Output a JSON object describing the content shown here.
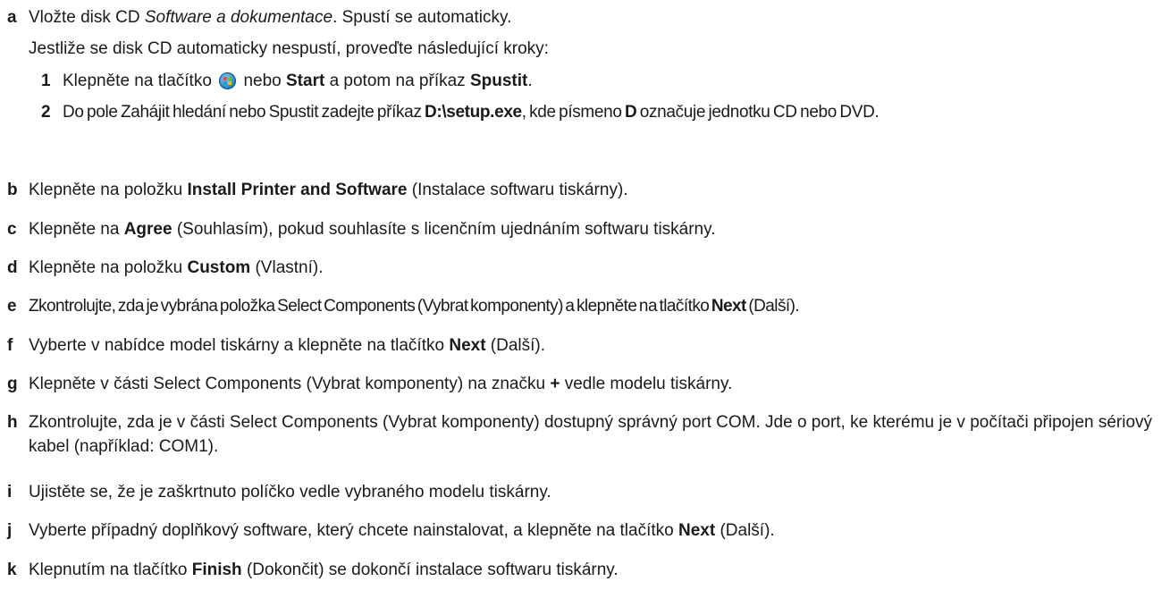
{
  "steps": [
    {
      "letter": "a",
      "parts": [
        "Vložte disk CD ",
        "Software a dokumentace",
        ". Spustí se automaticky."
      ],
      "line2": "Jestliže se disk CD automaticky nespustí, proveďte následující kroky:",
      "substeps": [
        {
          "num": "1",
          "parts": [
            "Klepněte na tlačítko ",
            " nebo ",
            "Start",
            " a potom na příkaz ",
            "Spustit",
            "."
          ]
        },
        {
          "num": "2",
          "parts": [
            "Do pole Zahájit hledání nebo Spustit zadejte příkaz ",
            "D:\\setup.exe",
            ", kde písmeno ",
            "D",
            " označuje jednotku CD nebo DVD."
          ]
        }
      ]
    },
    {
      "letter": "b",
      "parts": [
        "Klepněte na položku ",
        "Install Printer and Software",
        " (Instalace softwaru tiskárny)."
      ]
    },
    {
      "letter": "c",
      "parts": [
        "Klepněte na ",
        "Agree",
        " (Souhlasím), pokud souhlasíte s licenčním ujednáním softwaru tiskárny."
      ]
    },
    {
      "letter": "d",
      "parts": [
        "Klepněte na položku ",
        "Custom",
        " (Vlastní)."
      ]
    },
    {
      "letter": "e",
      "parts": [
        "Zkontrolujte, zda je vybrána položka Select Components (Vybrat komponenty) a klepněte na tlačítko ",
        "Next",
        " (Další)."
      ]
    },
    {
      "letter": "f",
      "parts": [
        "Vyberte v nabídce model tiskárny a klepněte na tlačítko ",
        "Next",
        " (Další)."
      ]
    },
    {
      "letter": "g",
      "parts": [
        "Klepněte v části Select Components (Vybrat komponenty) na značku ",
        "+",
        " vedle modelu tiskárny."
      ]
    },
    {
      "letter": "h",
      "parts": [
        "Zkontrolujte, zda je v části Select Components (Vybrat komponenty) dostupný správný port COM. Jde o port, ke kterému je v počítači připojen sériový kabel (například: COM1)."
      ]
    },
    {
      "letter": "i",
      "parts": [
        "Ujistěte se, že je zaškrtnuto políčko vedle vybraného modelu tiskárny."
      ]
    },
    {
      "letter": "j",
      "parts": [
        "Vyberte případný doplňkový software, který chcete nainstalovat, a klepněte na tlačítko ",
        "Next",
        " (Další)."
      ]
    },
    {
      "letter": "k",
      "parts": [
        "Klepnutím na tlačítko ",
        "Finish",
        " (Dokončit) se dokončí instalace softwaru tiskárny."
      ]
    }
  ]
}
